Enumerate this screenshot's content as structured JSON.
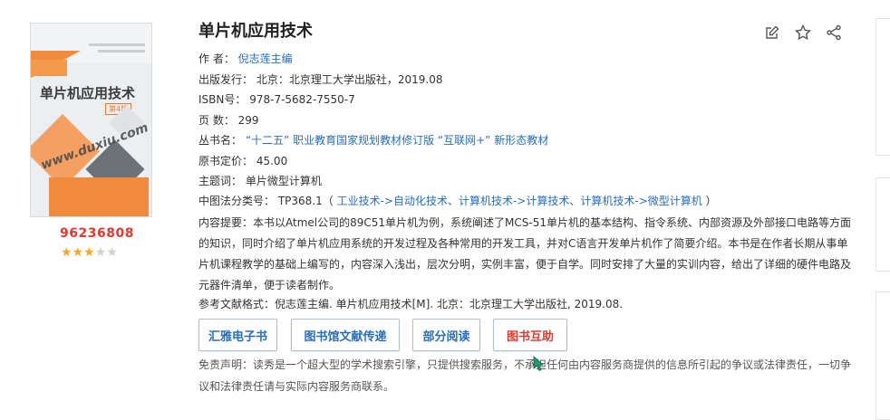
{
  "book": {
    "title": "单片机应用技术",
    "cover_title": "单片机应用技术",
    "cover_edition": "第4版",
    "cover_watermark": "www.duxiu.com",
    "id_number": "96236808",
    "rating": 3,
    "rating_max": 5
  },
  "fields": {
    "author_label": "作 者：",
    "author_value": "倪志莲主编",
    "publish_label": "出版发行：",
    "publish_value": "北京：北京理工大学出版社，2019.08",
    "isbn_label": "ISBN号：",
    "isbn_value": "978-7-5682-7550-7",
    "pages_label": "页 数：",
    "pages_value": "299",
    "series_label": "丛书名：",
    "series_value": "“十二五” 职业教育国家规划教材修订版 “互联网+” 新形态教材",
    "price_label": "原书定价：",
    "price_value": "45.00",
    "subject_label": "主题词：",
    "subject_value": "单片微型计算机",
    "clc_label": "中图法分类号：",
    "clc_code": "TP368.1（",
    "clc_path": "工业技术->自动化技术、计算机技术->计算技术、计算机技术->微型计算机",
    "clc_close": "）"
  },
  "summary": "内容提要：本书以Atmel公司的89C51单片机为例，系统阐述了MCS-51单片机的基本结构、指令系统、内部资源及外部接口电路等方面的知识，同时介绍了单片机应用系统的开发过程及各种常用的开发工具，并对C语言开发单片机作了简要介绍。本书是在作者长期从事单片机课程教学的基础上编写的，内容深入浅出，层次分明，实例丰富，便于自学。同时安排了大量的实训内容，给出了详细的硬件电路及元器件清单，便于读者制作。",
  "citation": "参考文献格式：倪志莲主编. 单片机应用技术[M]. 北京：北京理工大学出版社, 2019.08.",
  "buttons": {
    "ebook": "汇雅电子书",
    "delivery": "图书馆文献传递",
    "partial_read": "部分阅读",
    "mutual_help": "图书互助"
  },
  "disclaimer": "免责声明：读秀是一个超大型的学术搜索引擎，只提供搜索服务，不承担任何由内容服务商提供的信息所引起的争议或法律责任，一切争议和法律责任请与实际内容服务商联系。",
  "colors": {
    "link": "#2a6ebb",
    "accent_red": "#e03a2f",
    "star": "#f5a623"
  }
}
